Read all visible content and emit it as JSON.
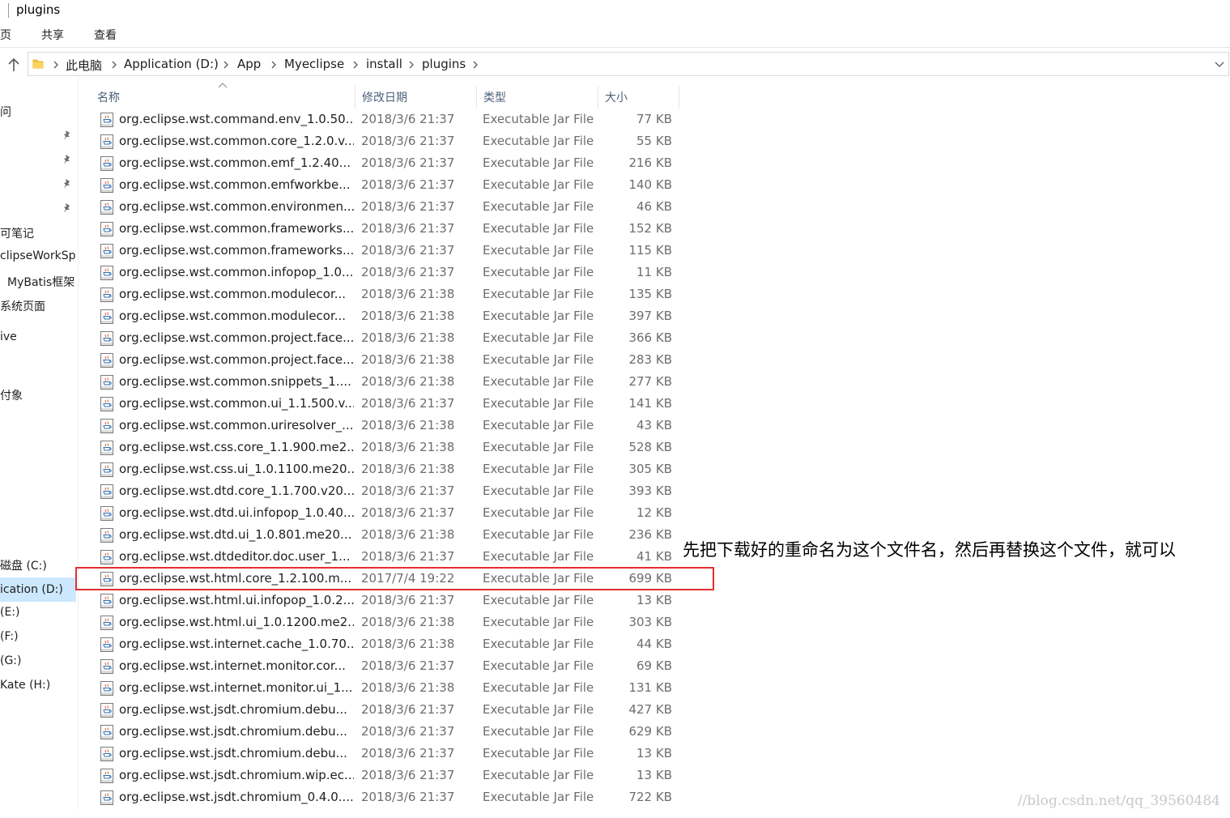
{
  "window": {
    "title": "plugins"
  },
  "ribbon": {
    "tabs": [
      "页",
      "共享",
      "查看"
    ]
  },
  "address": {
    "breadcrumbs": [
      "此电脑",
      "Application (D:)",
      "App",
      "Myeclipse",
      "install",
      "plugins"
    ]
  },
  "nav": {
    "items": [
      {
        "label": "问",
        "selected": false
      },
      {
        "label": "可笔记",
        "selected": false
      },
      {
        "label": "clipseWorkSp",
        "selected": false
      },
      {
        "label": "MyBatis框架",
        "selected": false
      },
      {
        "label": "系统页面",
        "selected": false
      },
      {
        "label": "ive",
        "selected": false
      },
      {
        "label": "付象",
        "selected": false
      },
      {
        "label": "磁盘 (C:)",
        "selected": false
      },
      {
        "label": "ication (D:)",
        "selected": true
      },
      {
        "label": "(E:)",
        "selected": false
      },
      {
        "label": "(F:)",
        "selected": false
      },
      {
        "label": "(G:)",
        "selected": false
      },
      {
        "label": "Kate (H:)",
        "selected": false
      }
    ]
  },
  "columns": {
    "name": "名称",
    "date": "修改日期",
    "type": "类型",
    "size": "大小"
  },
  "files": [
    {
      "name": "org.eclipse.wst.command.env_1.0.50...",
      "date": "2018/3/6 21:37",
      "type": "Executable Jar File",
      "size": "77 KB"
    },
    {
      "name": "org.eclipse.wst.common.core_1.2.0.v...",
      "date": "2018/3/6 21:37",
      "type": "Executable Jar File",
      "size": "55 KB"
    },
    {
      "name": "org.eclipse.wst.common.emf_1.2.40...",
      "date": "2018/3/6 21:37",
      "type": "Executable Jar File",
      "size": "216 KB"
    },
    {
      "name": "org.eclipse.wst.common.emfworkbe...",
      "date": "2018/3/6 21:37",
      "type": "Executable Jar File",
      "size": "140 KB"
    },
    {
      "name": "org.eclipse.wst.common.environmen...",
      "date": "2018/3/6 21:37",
      "type": "Executable Jar File",
      "size": "46 KB"
    },
    {
      "name": "org.eclipse.wst.common.frameworks...",
      "date": "2018/3/6 21:37",
      "type": "Executable Jar File",
      "size": "152 KB"
    },
    {
      "name": "org.eclipse.wst.common.frameworks...",
      "date": "2018/3/6 21:37",
      "type": "Executable Jar File",
      "size": "115 KB"
    },
    {
      "name": "org.eclipse.wst.common.infopop_1.0...",
      "date": "2018/3/6 21:37",
      "type": "Executable Jar File",
      "size": "11 KB"
    },
    {
      "name": "org.eclipse.wst.common.modulecor...",
      "date": "2018/3/6 21:38",
      "type": "Executable Jar File",
      "size": "135 KB"
    },
    {
      "name": "org.eclipse.wst.common.modulecor...",
      "date": "2018/3/6 21:38",
      "type": "Executable Jar File",
      "size": "397 KB"
    },
    {
      "name": "org.eclipse.wst.common.project.face...",
      "date": "2018/3/6 21:38",
      "type": "Executable Jar File",
      "size": "366 KB"
    },
    {
      "name": "org.eclipse.wst.common.project.face...",
      "date": "2018/3/6 21:38",
      "type": "Executable Jar File",
      "size": "283 KB"
    },
    {
      "name": "org.eclipse.wst.common.snippets_1....",
      "date": "2018/3/6 21:38",
      "type": "Executable Jar File",
      "size": "277 KB"
    },
    {
      "name": "org.eclipse.wst.common.ui_1.1.500.v...",
      "date": "2018/3/6 21:37",
      "type": "Executable Jar File",
      "size": "141 KB"
    },
    {
      "name": "org.eclipse.wst.common.uriresolver_...",
      "date": "2018/3/6 21:38",
      "type": "Executable Jar File",
      "size": "43 KB"
    },
    {
      "name": "org.eclipse.wst.css.core_1.1.900.me2...",
      "date": "2018/3/6 21:38",
      "type": "Executable Jar File",
      "size": "528 KB"
    },
    {
      "name": "org.eclipse.wst.css.ui_1.0.1100.me20...",
      "date": "2018/3/6 21:38",
      "type": "Executable Jar File",
      "size": "305 KB"
    },
    {
      "name": "org.eclipse.wst.dtd.core_1.1.700.v20...",
      "date": "2018/3/6 21:37",
      "type": "Executable Jar File",
      "size": "393 KB"
    },
    {
      "name": "org.eclipse.wst.dtd.ui.infopop_1.0.40...",
      "date": "2018/3/6 21:37",
      "type": "Executable Jar File",
      "size": "12 KB"
    },
    {
      "name": "org.eclipse.wst.dtd.ui_1.0.801.me20...",
      "date": "2018/3/6 21:38",
      "type": "Executable Jar File",
      "size": "236 KB"
    },
    {
      "name": "org.eclipse.wst.dtdeditor.doc.user_1...",
      "date": "2018/3/6 21:37",
      "type": "Executable Jar File",
      "size": "41 KB"
    },
    {
      "name": "org.eclipse.wst.html.core_1.2.100.m...",
      "date": "2017/7/4 19:22",
      "type": "Executable Jar File",
      "size": "699 KB"
    },
    {
      "name": "org.eclipse.wst.html.ui.infopop_1.0.2...",
      "date": "2018/3/6 21:37",
      "type": "Executable Jar File",
      "size": "13 KB"
    },
    {
      "name": "org.eclipse.wst.html.ui_1.0.1200.me2...",
      "date": "2018/3/6 21:38",
      "type": "Executable Jar File",
      "size": "303 KB"
    },
    {
      "name": "org.eclipse.wst.internet.cache_1.0.70...",
      "date": "2018/3/6 21:38",
      "type": "Executable Jar File",
      "size": "44 KB"
    },
    {
      "name": "org.eclipse.wst.internet.monitor.cor...",
      "date": "2018/3/6 21:37",
      "type": "Executable Jar File",
      "size": "69 KB"
    },
    {
      "name": "org.eclipse.wst.internet.monitor.ui_1...",
      "date": "2018/3/6 21:38",
      "type": "Executable Jar File",
      "size": "131 KB"
    },
    {
      "name": "org.eclipse.wst.jsdt.chromium.debu...",
      "date": "2018/3/6 21:37",
      "type": "Executable Jar File",
      "size": "427 KB"
    },
    {
      "name": "org.eclipse.wst.jsdt.chromium.debu...",
      "date": "2018/3/6 21:37",
      "type": "Executable Jar File",
      "size": "629 KB"
    },
    {
      "name": "org.eclipse.wst.jsdt.chromium.debu...",
      "date": "2018/3/6 21:37",
      "type": "Executable Jar File",
      "size": "13 KB"
    },
    {
      "name": "org.eclipse.wst.jsdt.chromium.wip.ec...",
      "date": "2018/3/6 21:37",
      "type": "Executable Jar File",
      "size": "13 KB"
    },
    {
      "name": "org.eclipse.wst.jsdt.chromium_0.4.0....",
      "date": "2018/3/6 21:37",
      "type": "Executable Jar File",
      "size": "722 KB"
    }
  ],
  "annotation": {
    "text": "先把下载好的重命名为这个文件名，然后再替换这个文件，就可以"
  },
  "watermark": {
    "text": "//blog.csdn.net/qq_39560484"
  },
  "colors": {
    "highlight_box": "#e03030",
    "nav_selected": "#cce8ff",
    "header_text": "#4c607a"
  },
  "icons": [
    "up-arrow-icon",
    "folder-icon",
    "chevron-right-icon",
    "chevron-down-icon",
    "pin-icon",
    "sort-ascending-icon",
    "jar-file-icon"
  ]
}
